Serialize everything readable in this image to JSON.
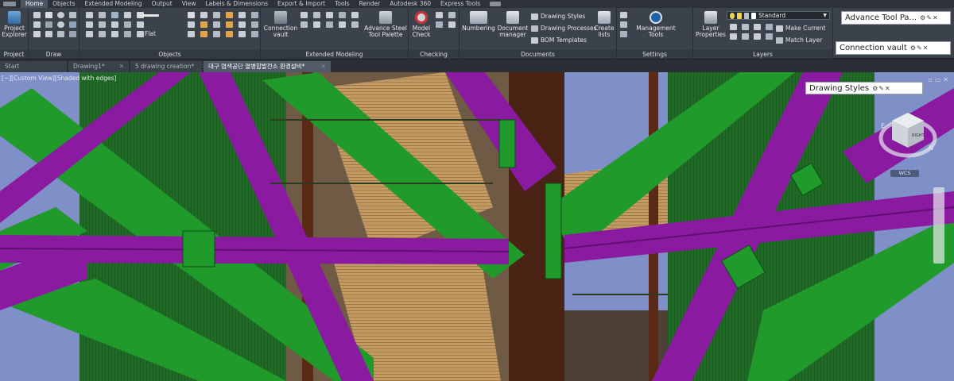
{
  "menu_tabs": [
    {
      "label": "Home",
      "active": true
    },
    {
      "label": "Objects",
      "active": false
    },
    {
      "label": "Extended Modeling",
      "active": false
    },
    {
      "label": "Output",
      "active": false
    },
    {
      "label": "View",
      "active": false
    },
    {
      "label": "Labels & Dimensions",
      "active": false
    },
    {
      "label": "Export & Import",
      "active": false
    },
    {
      "label": "Tools",
      "active": false
    },
    {
      "label": "Render",
      "active": false
    },
    {
      "label": "Autodesk 360",
      "active": false
    },
    {
      "label": "Express Tools",
      "active": false
    }
  ],
  "ribbon": {
    "project": {
      "title": "Project",
      "btn": "Project\nExplorer"
    },
    "draw": {
      "title": "Draw"
    },
    "objects": {
      "title": "Objects",
      "flat_label": "Flat"
    },
    "extended": {
      "title": "Extended Modeling",
      "conn_vault": "Connection\nvault",
      "adv_steel": "Advance Steel\nTool Palette"
    },
    "checking": {
      "title": "Checking",
      "model_check": "Model\nCheck"
    },
    "documents": {
      "title": "Documents",
      "numbering": "Numbering",
      "doc_manager": "Document\nmanager",
      "drawing_styles": "Drawing Styles",
      "drawing_processes": "Drawing Processes",
      "bom_templates": "BOM Templates",
      "create_lists": "Create\nlists"
    },
    "settings": {
      "title": "Settings",
      "mgmt": "Management\nTools"
    },
    "layers": {
      "title": "Layers",
      "layer_props": "Layer\nProperties",
      "layer_combo": "Standard",
      "make_current": "Make Current",
      "match_layer": "Match Layer"
    }
  },
  "palettes": {
    "advance_tool": "Advance Tool Pa...",
    "connection_vault": "Connection vault",
    "drawing_styles": "Drawing Styles"
  },
  "doc_tabs": [
    {
      "label": "Start",
      "active": false,
      "closable": false
    },
    {
      "label": "Drawing1*",
      "active": false,
      "closable": true
    },
    {
      "label": "5 drawing creation*",
      "active": false,
      "closable": true
    },
    {
      "label": "대구 염색공단 열병합발전소 환경설비*",
      "active": true,
      "closable": true
    }
  ],
  "viewport": {
    "view_label": "[−][Custom View][Shaded with edges]",
    "viewcube_face": "RIGHT",
    "compass_letters": [
      "E",
      "N"
    ],
    "wcs": "WCS"
  },
  "colors": {
    "background_sky": "#7f8fc8",
    "beam_green": "#1f9a2b",
    "beam_purple": "#8a1aa0",
    "column_brown": "#4a2314",
    "panel_green": "#1c6b22",
    "grating": "#c29a62"
  }
}
